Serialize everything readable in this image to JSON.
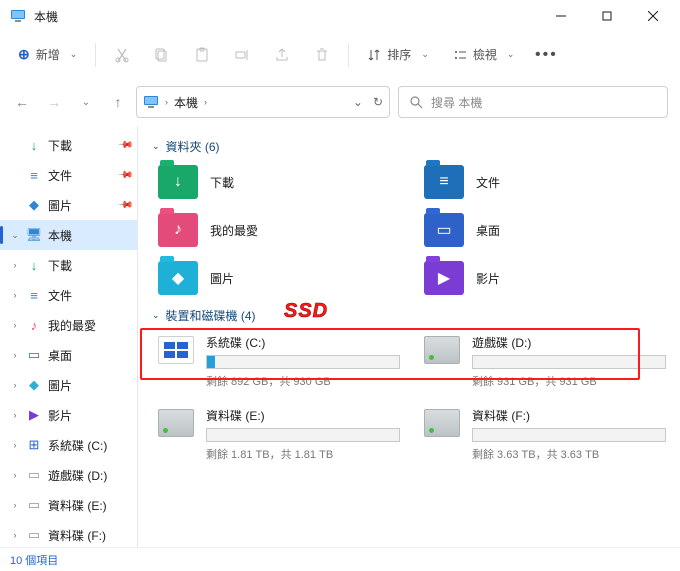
{
  "window": {
    "title": "本機"
  },
  "toolbar": {
    "new_label": "新增",
    "sort_label": "排序",
    "view_label": "檢視"
  },
  "address": {
    "crumb": "本機",
    "search_placeholder": "搜尋 本機"
  },
  "sidebar": {
    "items": [
      {
        "label": "下載",
        "iconColor": "#1fa463",
        "pin": true,
        "glyph": "↓"
      },
      {
        "label": "文件",
        "iconColor": "#2f86d3",
        "pin": true,
        "glyph": "≡"
      },
      {
        "label": "圖片",
        "iconColor": "#2f86d3",
        "pin": true,
        "glyph": "◆"
      },
      {
        "label": "本機",
        "iconColor": "#2f86d3",
        "tw": "⌄",
        "sel": true,
        "glyph": "🖥"
      },
      {
        "label": "下載",
        "iconColor": "#1fa463",
        "tw": "›",
        "glyph": "↓"
      },
      {
        "label": "文件",
        "iconColor": "#2f86d3",
        "tw": "›",
        "glyph": "≡"
      },
      {
        "label": "我的最愛",
        "iconColor": "#e34b7b",
        "tw": "›",
        "glyph": "♪"
      },
      {
        "label": "桌面",
        "iconColor": "#2f62c9",
        "tw": "›",
        "glyph": "▭"
      },
      {
        "label": "圖片",
        "iconColor": "#2fb0d3",
        "tw": "›",
        "glyph": "◆"
      },
      {
        "label": "影片",
        "iconColor": "#7a3cd3",
        "tw": "›",
        "glyph": "▶"
      },
      {
        "label": "系統碟 (C:)",
        "iconColor": "#2564cf",
        "tw": "›",
        "glyph": "⊞"
      },
      {
        "label": "遊戲碟 (D:)",
        "iconColor": "#8f969b",
        "tw": "›",
        "glyph": "▭"
      },
      {
        "label": "資料碟 (E:)",
        "iconColor": "#8f969b",
        "tw": "›",
        "glyph": "▭"
      },
      {
        "label": "資料碟 (F:)",
        "iconColor": "#8f969b",
        "tw": "›",
        "glyph": "▭"
      }
    ]
  },
  "groups": {
    "folders_label": "資料夾 (6)",
    "drives_label": "裝置和磁碟機 (4)"
  },
  "folders": [
    {
      "label": "下載",
      "color": "#19a86a",
      "glyph": "↓"
    },
    {
      "label": "文件",
      "color": "#1e6fb8",
      "glyph": "≡"
    },
    {
      "label": "我的最愛",
      "color": "#e34b7b",
      "glyph": "♪"
    },
    {
      "label": "桌面",
      "color": "#2f62c9",
      "glyph": "▭"
    },
    {
      "label": "圖片",
      "color": "#1eb0d6",
      "glyph": "◆"
    },
    {
      "label": "影片",
      "color": "#7a3cd3",
      "glyph": "▶"
    }
  ],
  "drives": [
    {
      "name": "系統碟 (C:)",
      "sub": "剩餘 892 GB，共 930 GB",
      "fill": 4,
      "kind": "win"
    },
    {
      "name": "遊戲碟 (D:)",
      "sub": "剩餘 931 GB，共 931 GB",
      "fill": 0,
      "kind": "hdd"
    },
    {
      "name": "資料碟 (E:)",
      "sub": "剩餘 1.81 TB，共 1.81 TB",
      "fill": 0,
      "kind": "hdd"
    },
    {
      "name": "資料碟 (F:)",
      "sub": "剩餘 3.63 TB，共 3.63 TB",
      "fill": 0,
      "kind": "hdd"
    }
  ],
  "annotation": {
    "ssd": "SSD"
  },
  "status": {
    "text": "10 個項目"
  }
}
